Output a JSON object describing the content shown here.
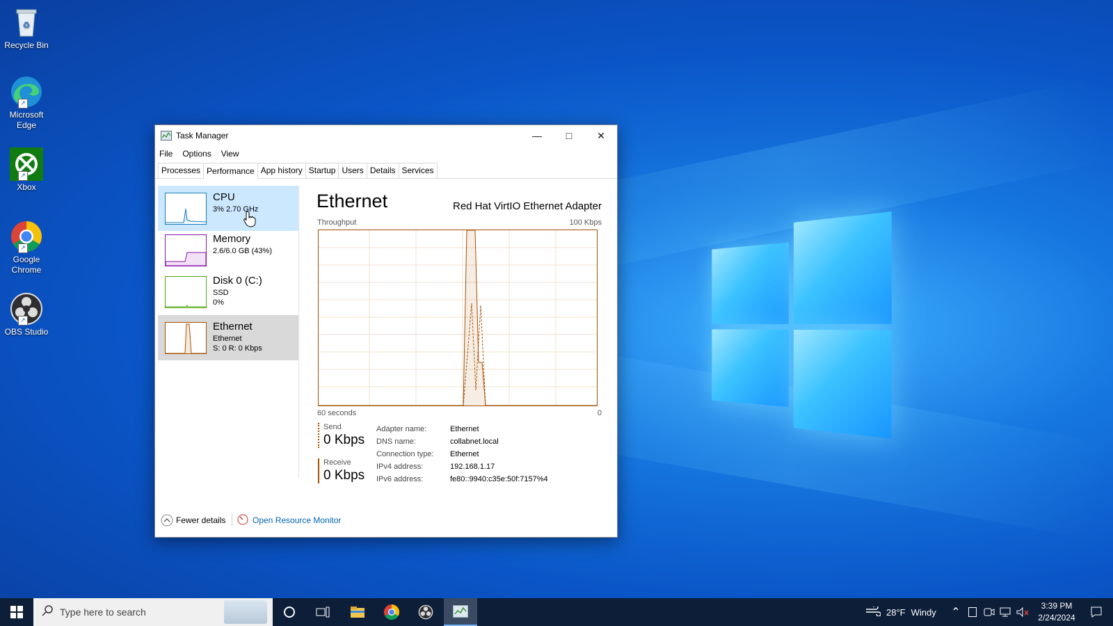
{
  "desktop": {
    "icons": [
      {
        "label": "Recycle Bin"
      },
      {
        "label": "Microsoft Edge"
      },
      {
        "label": "Xbox"
      },
      {
        "label": "Google Chrome"
      },
      {
        "label": "OBS Studio"
      }
    ]
  },
  "window": {
    "title": "Task Manager",
    "menu": [
      "File",
      "Options",
      "View"
    ],
    "tabs": [
      "Processes",
      "Performance",
      "App history",
      "Startup",
      "Users",
      "Details",
      "Services"
    ],
    "active_tab": "Performance",
    "sidebar": [
      {
        "name": "CPU",
        "line1": "3% 2.70 GHz",
        "line2": ""
      },
      {
        "name": "Memory",
        "line1": "2.6/6.0 GB (43%)",
        "line2": ""
      },
      {
        "name": "Disk 0 (C:)",
        "line1": "SSD",
        "line2": "0%"
      },
      {
        "name": "Ethernet",
        "line1": "Ethernet",
        "line2": "S: 0 R: 0 Kbps"
      }
    ],
    "detail": {
      "title": "Ethernet",
      "adapter": "Red Hat VirtIO Ethernet Adapter",
      "graph_label": "Throughput",
      "graph_max": "100 Kbps",
      "x_left": "60 seconds",
      "x_right": "0",
      "send_label": "Send",
      "send_value": "0 Kbps",
      "receive_label": "Receive",
      "receive_value": "0 Kbps",
      "info": [
        {
          "k": "Adapter name:",
          "v": "Ethernet"
        },
        {
          "k": "DNS name:",
          "v": "collabnet.local"
        },
        {
          "k": "Connection type:",
          "v": "Ethernet"
        },
        {
          "k": "IPv4 address:",
          "v": "192.168.1.17"
        },
        {
          "k": "IPv6 address:",
          "v": "fe80::9940:c35e:50f:7157%4"
        }
      ]
    },
    "footer": {
      "fewer": "Fewer details",
      "resmon": "Open Resource Monitor"
    }
  },
  "taskbar": {
    "search_placeholder": "Type here to search",
    "weather_temp": "28°F",
    "weather_text": "Windy",
    "time": "3:39 PM",
    "date": "2/24/2024"
  },
  "colors": {
    "ethernet": "#a74f01",
    "cpu": "#117dbb",
    "memory": "#8b12ae",
    "disk": "#4da60c"
  }
}
